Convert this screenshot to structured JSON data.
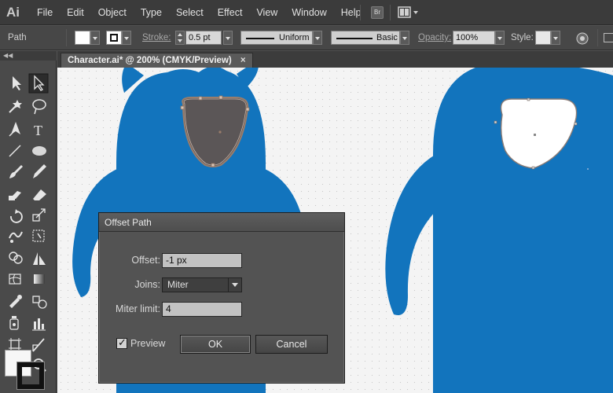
{
  "app": {
    "logo": "Ai"
  },
  "menu": [
    "File",
    "Edit",
    "Object",
    "Type",
    "Select",
    "Effect",
    "View",
    "Window",
    "Help"
  ],
  "toolbar_icons": {
    "bridge": "Br",
    "arrange": "arrange-documents-icon"
  },
  "control_bar": {
    "selection_type": "Path",
    "stroke_label": "Stroke:",
    "stroke_weight": "0.5 pt",
    "width_profile": "Uniform",
    "brush": "Basic",
    "opacity_label": "Opacity:",
    "opacity_value": "100%",
    "style_label": "Style:"
  },
  "document_tab": {
    "title": "Character.ai* @ 200% (CMYK/Preview)",
    "close": "×"
  },
  "colors": {
    "character_blue": "#1274bd",
    "selection_outline": "#9a7d6b"
  },
  "dialog": {
    "title": "Offset Path",
    "offset_label": "Offset:",
    "offset_value": "-1 px",
    "joins_label": "Joins:",
    "joins_value": "Miter",
    "miter_label": "Miter limit:",
    "miter_value": "4",
    "preview_label": "Preview",
    "preview_checked": true,
    "ok_label": "OK",
    "cancel_label": "Cancel"
  }
}
